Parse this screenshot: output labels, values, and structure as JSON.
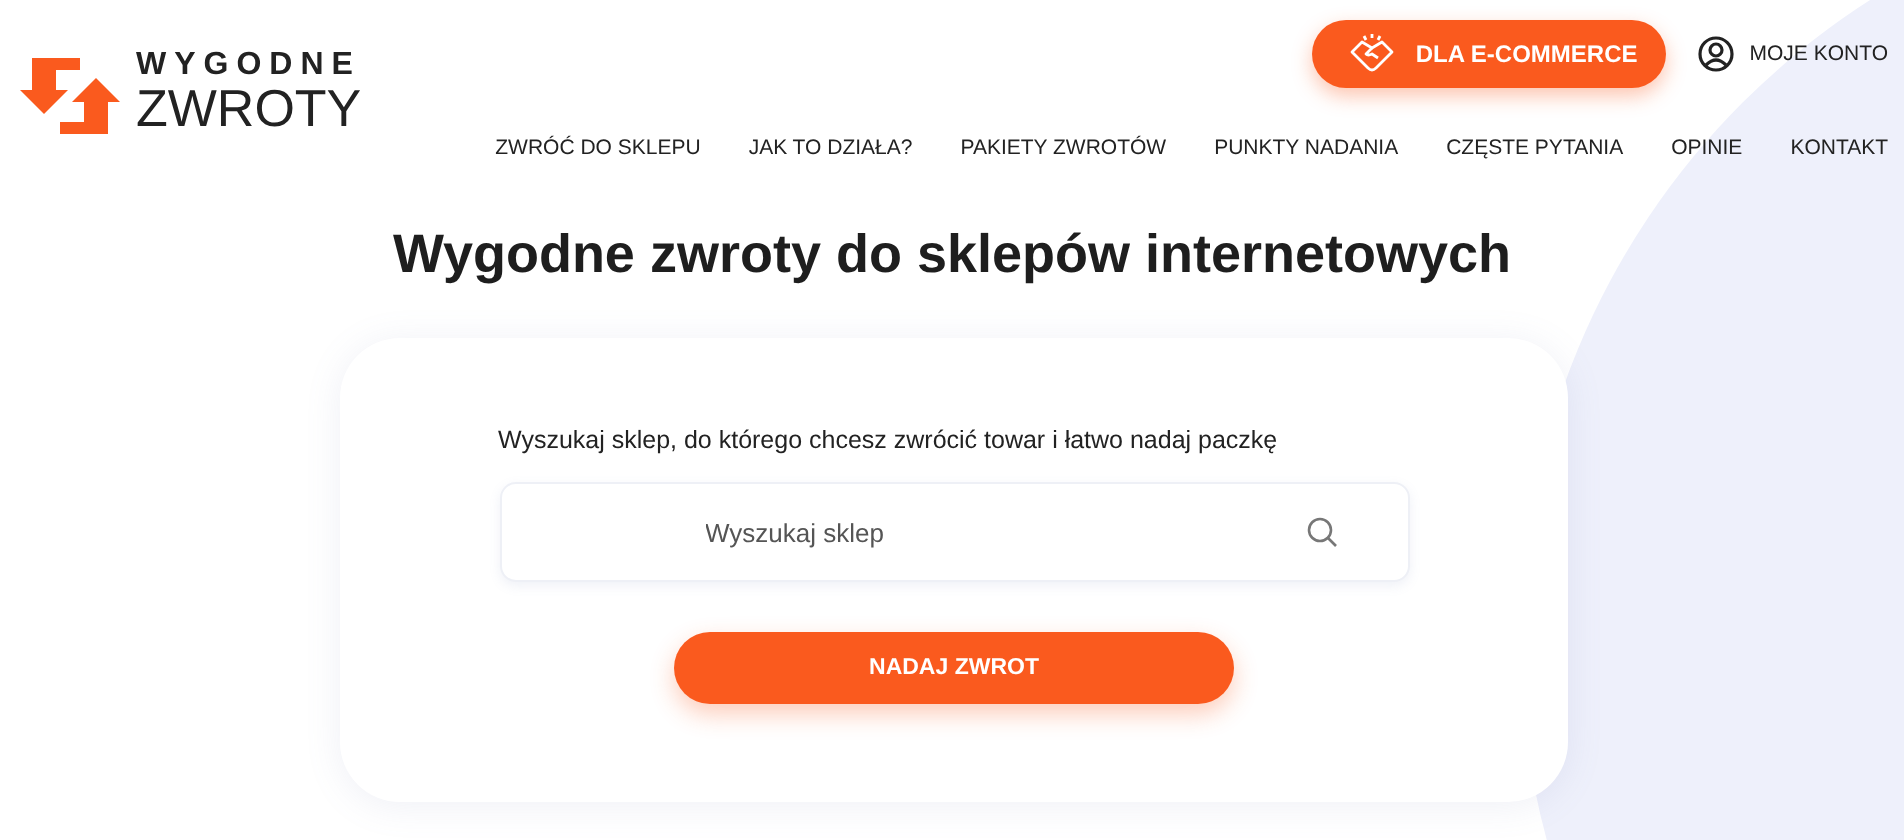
{
  "logo": {
    "line_1": "WYGODNE",
    "line_2": "ZWROTY"
  },
  "ecommerce_button": {
    "label": "DLA E-COMMERCE"
  },
  "account_link": {
    "label": "MOJE KONTO"
  },
  "nav": [
    "ZWRÓĆ DO SKLEPU",
    "JAK TO DZIAŁA?",
    "PAKIETY ZWROTÓW",
    "PUNKTY NADANIA",
    "CZĘSTE PYTANIA",
    "OPINIE",
    "KONTAKT"
  ],
  "heading": "Wygodne zwroty do sklepów internetowych",
  "search_card": {
    "prompt": "Wyszukaj sklep, do którego chcesz zwrócić towar i łatwo nadaj paczkę",
    "placeholder": "Wyszukaj sklep",
    "button": "NADAJ ZWROT"
  }
}
